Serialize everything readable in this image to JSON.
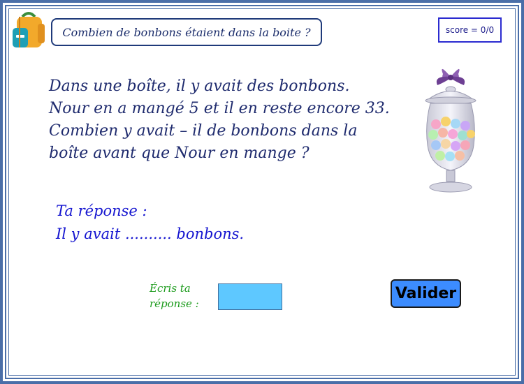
{
  "header": {
    "question": "Combien de bonbons étaient dans la boite ?",
    "score": "score = 0/0"
  },
  "problem": {
    "lines": [
      "Dans une boîte,  il y avait des bonbons.",
      "Nour en a mangé 5 et il en reste encore 33.",
      "Combien y avait – il de bonbons dans la",
      "boîte avant que Nour en mange ?"
    ]
  },
  "answer": {
    "lines": [
      "Ta réponse :",
      "Il y avait .......... bonbons."
    ]
  },
  "input": {
    "label_lines": [
      "Écris ta",
      "réponse :"
    ],
    "value": ""
  },
  "buttons": {
    "validate": "Valider"
  },
  "icons": {
    "backpack": "backpack-icon",
    "jar": "candy-jar-image"
  },
  "colors": {
    "frame": "#4a6ea8",
    "input_bg": "#5ec8ff",
    "button_bg": "#3c8cff",
    "answer_text": "#1616d0",
    "label_text": "#1a9a1a"
  }
}
